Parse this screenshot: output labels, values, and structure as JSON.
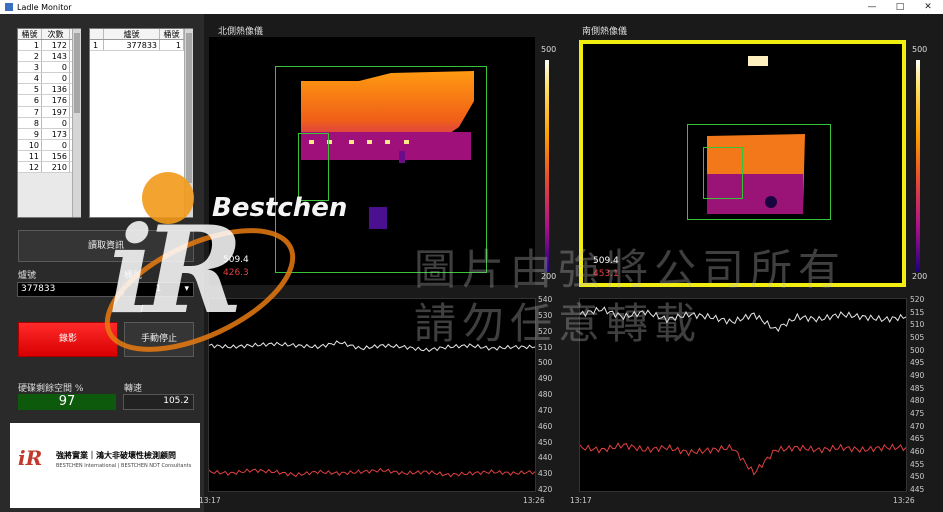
{
  "window": {
    "title": "Ladle Monitor",
    "min": "—",
    "max": "□",
    "close": "✕"
  },
  "table1": {
    "headers": [
      "桶號",
      "次數"
    ],
    "rows": [
      [
        "1",
        "172"
      ],
      [
        "2",
        "143"
      ],
      [
        "3",
        "0"
      ],
      [
        "4",
        "0"
      ],
      [
        "5",
        "136"
      ],
      [
        "6",
        "176"
      ],
      [
        "7",
        "197"
      ],
      [
        "8",
        "0"
      ],
      [
        "9",
        "173"
      ],
      [
        "10",
        "0"
      ],
      [
        "11",
        "156"
      ],
      [
        "12",
        "210"
      ]
    ]
  },
  "table2": {
    "headers": [
      "",
      "爐號",
      "桶號"
    ],
    "rows": [
      [
        "1",
        "377833",
        "1"
      ]
    ]
  },
  "controls": {
    "read_button": "讀取資訊",
    "furnace_label": "爐號",
    "furnace_value": "377833",
    "ladle_label": "桶號",
    "ladle_value": "1",
    "record_button": "錄影",
    "stop_button": "手動停止",
    "disk_label": "硬碟剩餘空間 %",
    "disk_value": "97",
    "speed_label": "轉速",
    "speed_value": "105.2"
  },
  "company": {
    "name_cn": "強將實業｜鴻大非破壞性檢測顧問",
    "name_en": "BESTCHEN International | BESTCHEN NDT Consultants",
    "brand": "Bestchen",
    "logo_letters": "iR"
  },
  "watermark": {
    "line1": "圖片由強將公司所有",
    "line2": "請勿任意轉載"
  },
  "north": {
    "title": "北側熱像儀",
    "scale_max": "500",
    "scale_min": "200",
    "max_temp": "509.4",
    "min_temp": "426.3",
    "chart_y_ticks": [
      "540",
      "530",
      "520",
      "510",
      "500",
      "490",
      "480",
      "470",
      "460",
      "450",
      "440",
      "430",
      "420"
    ],
    "x_start": "13:17",
    "x_end": "13:26"
  },
  "south": {
    "title": "南側熱像儀",
    "scale_max": "500",
    "scale_min": "200",
    "max_temp": "509.4",
    "min_temp": "453.1",
    "chart_y_ticks": [
      "520",
      "515",
      "510",
      "505",
      "500",
      "495",
      "490",
      "485",
      "480",
      "475",
      "470",
      "465",
      "460",
      "455",
      "450",
      "445"
    ],
    "x_start": "13:17",
    "x_end": "13:26"
  },
  "colors": {
    "record_red": "#e00000",
    "disk_green": "#0d5a0d",
    "roi_green": "#37c437",
    "highlight_yellow": "#f2ee10",
    "max_line": "#e8e8e8",
    "min_line": "#e04040"
  },
  "chart_data": [
    {
      "type": "line",
      "title": "",
      "xlabel": "",
      "ylabel": "",
      "x": [
        "13:17",
        "13:26"
      ],
      "ylim": [
        420,
        540
      ],
      "series": [
        {
          "values": [
            511,
            510,
            511,
            512,
            511,
            510,
            513,
            509,
            511,
            510,
            508,
            510,
            511,
            509,
            510,
            510
          ]
        },
        {
          "values": [
            432,
            431,
            433,
            432,
            430,
            432,
            431,
            432,
            433,
            431,
            432,
            430,
            431,
            432,
            431,
            432
          ]
        }
      ]
    },
    {
      "type": "line",
      "title": "",
      "xlabel": "",
      "ylabel": "",
      "x": [
        "13:17",
        "13:26"
      ],
      "ylim": [
        445,
        520
      ],
      "series": [
        {
          "values": [
            514,
            516,
            513,
            515,
            512,
            514,
            513,
            511,
            514,
            508,
            513,
            512,
            514,
            513,
            512,
            513
          ]
        },
        {
          "values": [
            462,
            461,
            463,
            461,
            462,
            460,
            461,
            462,
            452,
            461,
            462,
            461,
            462,
            461,
            462,
            462
          ]
        }
      ]
    }
  ]
}
